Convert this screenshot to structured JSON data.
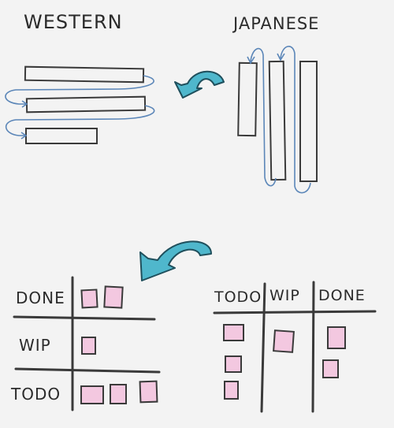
{
  "top": {
    "western_label": "WESTERN",
    "japanese_label": "JAPANESE"
  },
  "board_left": {
    "rows": [
      "DONE",
      "WIP",
      "TODO"
    ]
  },
  "board_right": {
    "columns": [
      "TODO",
      "WIP",
      "DONE"
    ]
  },
  "colors": {
    "ink": "#3a3a3a",
    "arrow": "#4fb7cc",
    "arrow_outline": "#1f4f5c",
    "flow_line": "#5b86b8",
    "card_fill": "#f3c8e0",
    "card_stroke": "#3a3a3a"
  }
}
